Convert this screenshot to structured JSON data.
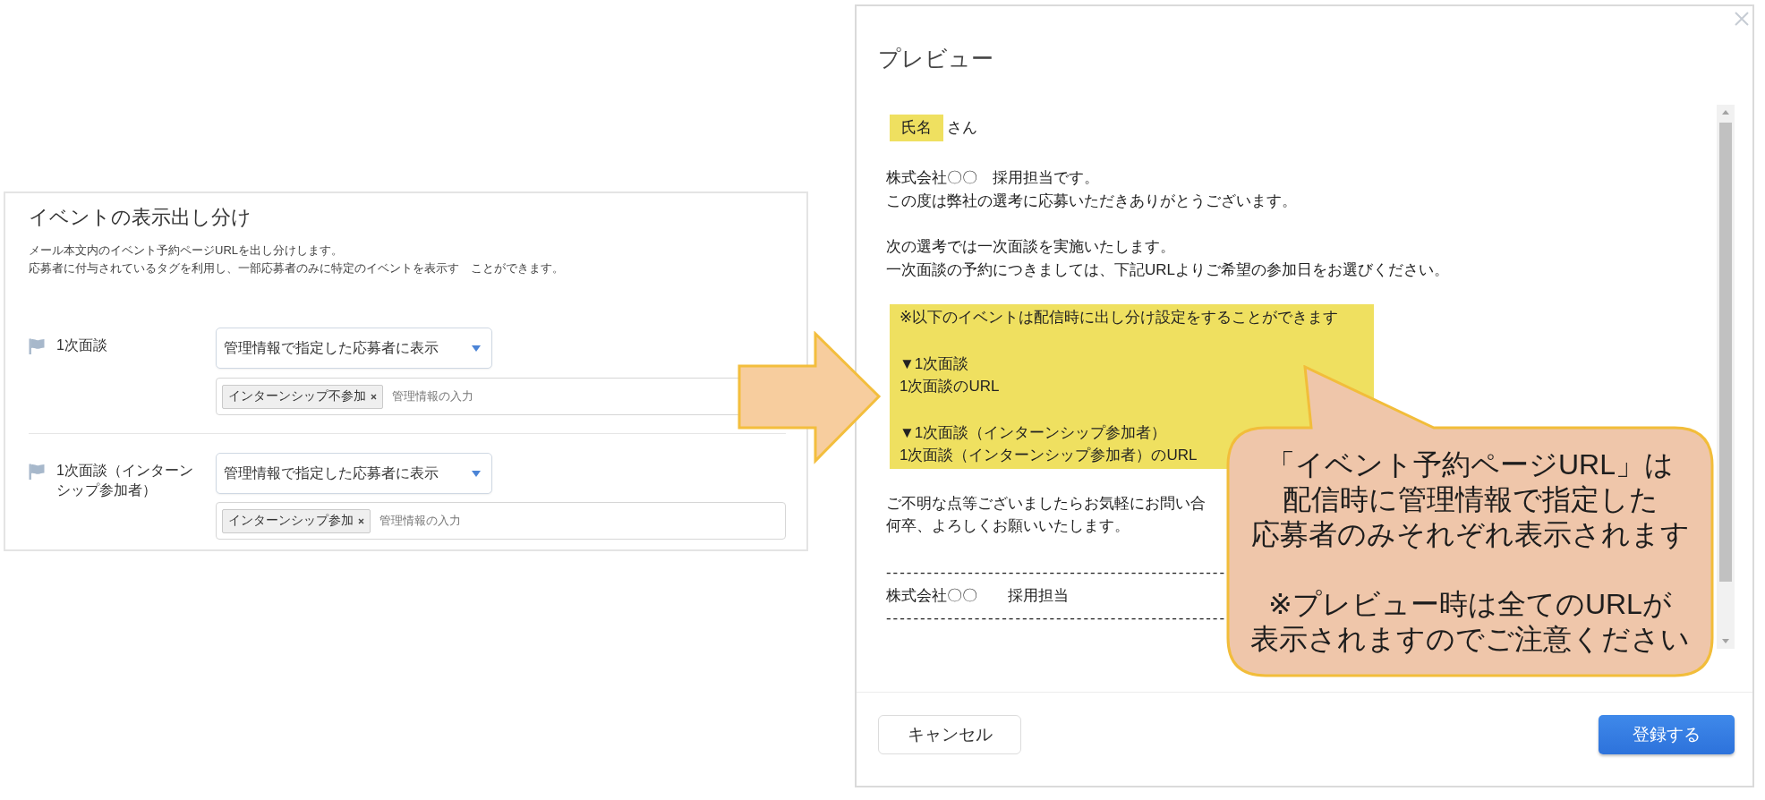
{
  "settings_panel": {
    "title": "イベントの表示出し分け",
    "description": [
      "メール本文内のイベント予約ページURLを出し分けします。",
      "応募者に付与されているタグを利用し、一部応募者のみに特定のイベントを表示す　ことができます。"
    ],
    "events": [
      {
        "name": "1次面談",
        "display": "管理情報で指定した応募者に表示",
        "tags": [
          "インターンシップ不参加"
        ],
        "tag_placeholder": "管理情報の入力"
      },
      {
        "name": "1次面談（インターンシップ参加者）",
        "display": "管理情報で指定した応募者に表示",
        "tags": [
          "インターンシップ参加"
        ],
        "tag_placeholder": "管理情報の入力"
      }
    ]
  },
  "preview_dialog": {
    "title": "プレビュー",
    "body": [
      {
        "kind": "greeting",
        "name_tag": "氏名",
        "suffix": "さん"
      },
      {
        "kind": "paragraph",
        "lines": [
          "株式会社〇〇　採用担当です。",
          "この度は弊社の選考に応募いただきありがとうございます。"
        ]
      },
      {
        "kind": "paragraph",
        "lines": [
          "次の選考では一次面談を実施いたします。",
          "一次面談の予約につきましては、下記URLよりご希望の参加日をお選びください。"
        ]
      },
      {
        "kind": "highlight",
        "groups": [
          [
            "※以下のイベントは配信時に出し分け設定をすることができます"
          ],
          [
            "▼1次面談",
            "1次面談のURL"
          ],
          [
            "▼1次面談（インターンシップ参加者）",
            "1次面談（インターンシップ参加者）のURL"
          ]
        ]
      },
      {
        "kind": "paragraph",
        "lines": [
          "ご不明な点等ございましたらお気軽にお問い合",
          "何卒、よろしくお願いいたします。"
        ]
      },
      {
        "kind": "signature",
        "rule_above": "--------------------------------------------------",
        "text": "株式会社〇〇　　採用担当",
        "rule_below": "--------------------------------------------------"
      }
    ],
    "buttons": [
      {
        "label": "キャンセル",
        "kind": "secondary"
      },
      {
        "label": "登録する",
        "kind": "primary"
      }
    ]
  },
  "callout": {
    "paragraphs": [
      [
        "「イベント予約ページURL」は",
        "配信時に管理情報で指定した",
        "応募者のみそれぞれ表示されます"
      ],
      [
        "※プレビュー時は全てのURLが",
        "表示されますのでご注意ください"
      ]
    ]
  }
}
